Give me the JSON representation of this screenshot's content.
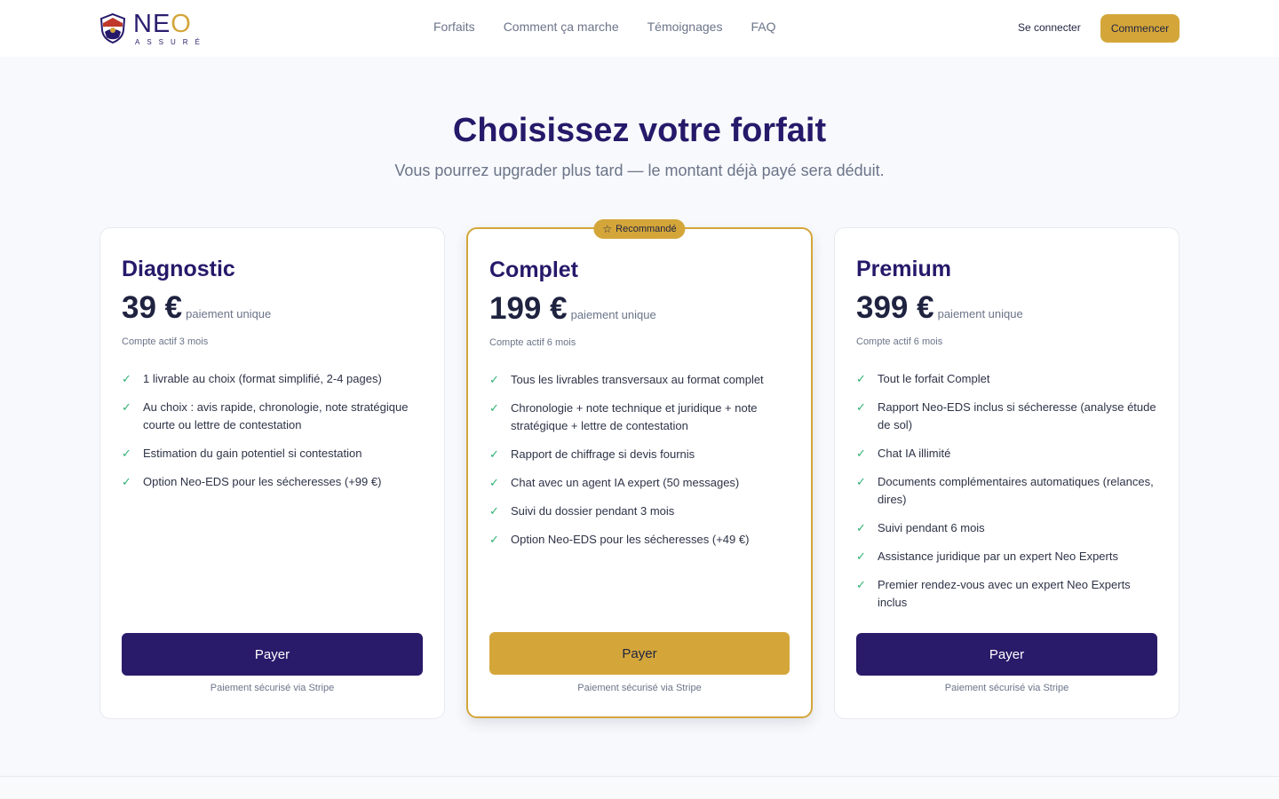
{
  "header": {
    "logo_word_main": "NE",
    "logo_word_accent": "O",
    "logo_sub": "ASSURÉ",
    "nav": [
      "Forfaits",
      "Comment ça marche",
      "Témoignages",
      "FAQ"
    ],
    "login": "Se connecter",
    "cta": "Commencer"
  },
  "hero": {
    "title": "Choisissez votre forfait",
    "subtitle": "Vous pourrez upgrader plus tard — le montant déjà payé sera déduit."
  },
  "plans": [
    {
      "name": "Diagnostic",
      "price": "39 €",
      "price_note": "paiement unique",
      "active": "Compte actif 3 mois",
      "features": [
        "1 livrable au choix (format simplifié, 2-4 pages)",
        "Au choix : avis rapide, chronologie, note stratégique courte ou lettre de contestation",
        "Estimation du gain potentiel si contestation",
        "Option Neo-EDS pour les sécheresses (+99 €)"
      ],
      "button": "Payer",
      "secure": "Paiement sécurisé via Stripe"
    },
    {
      "name": "Complet",
      "badge": "Recommandé",
      "price": "199 €",
      "price_note": "paiement unique",
      "active": "Compte actif 6 mois",
      "features": [
        "Tous les livrables transversaux au format complet",
        "Chronologie + note technique et juridique + note stratégique + lettre de contestation",
        "Rapport de chiffrage si devis fournis",
        "Chat avec un agent IA expert (50 messages)",
        "Suivi du dossier pendant 3 mois",
        "Option Neo-EDS pour les sécheresses (+49 €)"
      ],
      "button": "Payer",
      "secure": "Paiement sécurisé via Stripe"
    },
    {
      "name": "Premium",
      "price": "399 €",
      "price_note": "paiement unique",
      "active": "Compte actif 6 mois",
      "features": [
        "Tout le forfait Complet",
        "Rapport Neo-EDS inclus si sécheresse (analyse étude de sol)",
        "Chat IA illimité",
        "Documents complémentaires automatiques (relances, dires)",
        "Suivi pendant 6 mois",
        "Assistance juridique par un expert Neo Experts",
        "Premier rendez-vous avec un expert Neo Experts inclus"
      ],
      "button": "Payer",
      "secure": "Paiement sécurisé via Stripe"
    }
  ],
  "colors": {
    "brand_navy": "#26196a",
    "accent_gold": "#d4a63a",
    "check_green": "#2fb174"
  }
}
